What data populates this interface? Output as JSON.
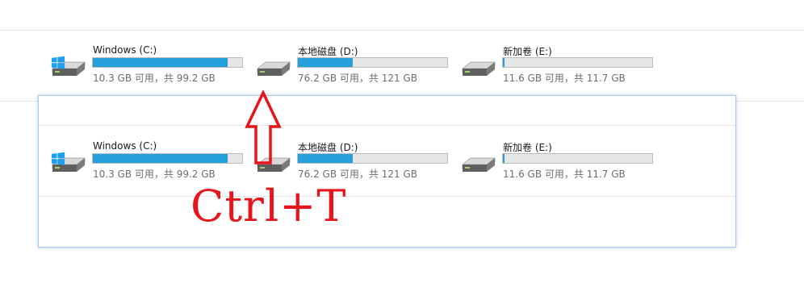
{
  "colors": {
    "used_bar": "#26a0da",
    "free_bar": "#e6e6e6",
    "annotation": "#e8141b",
    "selection_border": "#aac8f0"
  },
  "drives_top": [
    {
      "name": "Windows (C:)",
      "info": "10.3 GB 可用，共 99.2 GB",
      "used_fraction": 0.9,
      "icon": "windows-drive-icon"
    },
    {
      "name": "本地磁盘 (D:)",
      "info": "76.2 GB 可用，共 121 GB",
      "used_fraction": 0.37,
      "icon": "hard-drive-icon"
    },
    {
      "name": "新加卷 (E:)",
      "info": "11.6 GB 可用，共 11.7 GB",
      "used_fraction": 0.01,
      "icon": "hard-drive-icon"
    }
  ],
  "drives_bottom": [
    {
      "name": "Windows (C:)",
      "info": "10.3 GB 可用，共 99.2 GB",
      "used_fraction": 0.9,
      "icon": "windows-drive-icon"
    },
    {
      "name": "本地磁盘 (D:)",
      "info": "76.2 GB 可用，共 121 GB",
      "used_fraction": 0.37,
      "icon": "hard-drive-icon"
    },
    {
      "name": "新加卷 (E:)",
      "info": "11.6 GB 可用，共 11.7 GB",
      "used_fraction": 0.01,
      "icon": "hard-drive-icon"
    }
  ],
  "annotation": {
    "text": "Ctrl+T",
    "icon": "up-arrow-icon"
  }
}
